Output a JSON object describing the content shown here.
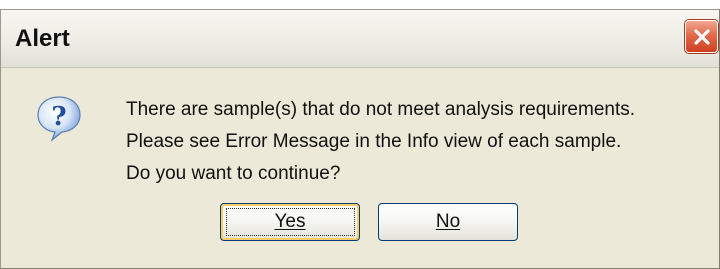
{
  "window": {
    "title": "Alert"
  },
  "icons": {
    "close": "close-icon",
    "help": "question-mark-icon"
  },
  "message": {
    "lines": [
      "There are sample(s) that do not meet analysis requirements.",
      "Please see Error Message in the Info view of each sample.",
      "Do you want to continue?"
    ]
  },
  "buttons": {
    "yes_label": "Yes",
    "no_label": "No"
  },
  "colors": {
    "dialog_bg": "#ece9d8",
    "close_button": "#e46a4c",
    "button_border": "#003c74",
    "focus_highlight": "#ffcc66",
    "help_icon_blue": "#2a6bc4"
  }
}
